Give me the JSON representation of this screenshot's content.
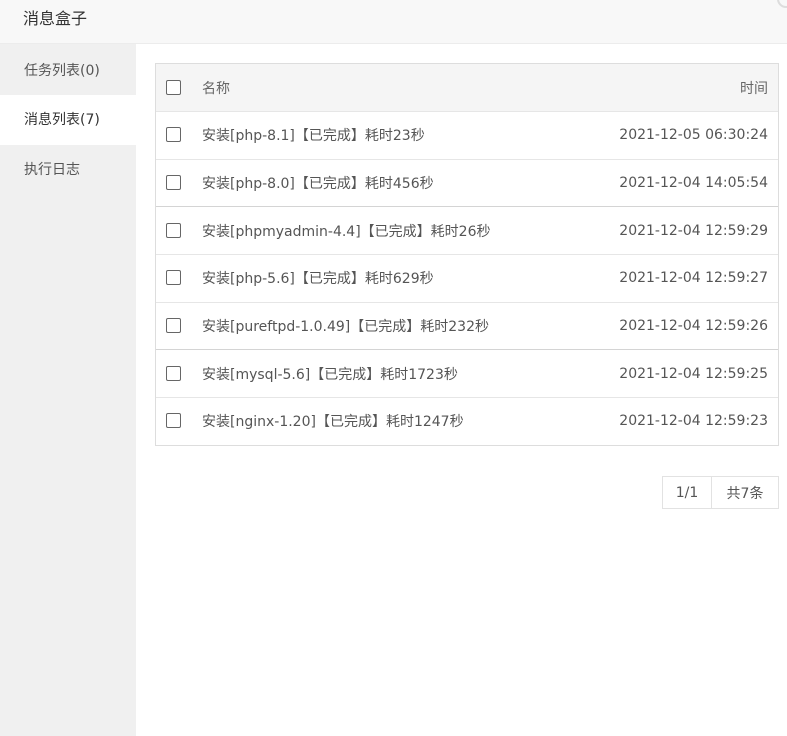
{
  "window": {
    "title": "消息盒子"
  },
  "sidebar": {
    "items": [
      {
        "label": "任务列表(0)",
        "active": false
      },
      {
        "label": "消息列表(7)",
        "active": true
      },
      {
        "label": "执行日志",
        "active": false
      }
    ]
  },
  "table": {
    "headers": {
      "name": "名称",
      "time": "时间"
    },
    "rows": [
      {
        "name": "安装[php-8.1]【已完成】耗时23秒",
        "time": "2021-12-05 06:30:24"
      },
      {
        "name": "安装[php-8.0]【已完成】耗时456秒",
        "time": "2021-12-04 14:05:54"
      },
      {
        "name": "安装[phpmyadmin-4.4]【已完成】耗时26秒",
        "time": "2021-12-04 12:59:29"
      },
      {
        "name": "安装[php-5.6]【已完成】耗时629秒",
        "time": "2021-12-04 12:59:27"
      },
      {
        "name": "安装[pureftpd-1.0.49]【已完成】耗时232秒",
        "time": "2021-12-04 12:59:26"
      },
      {
        "name": "安装[mysql-5.6]【已完成】耗时1723秒",
        "time": "2021-12-04 12:59:25"
      },
      {
        "name": "安装[nginx-1.20]【已完成】耗时1247秒",
        "time": "2021-12-04 12:59:23"
      }
    ]
  },
  "pagination": {
    "page": "1/1",
    "total": "共7条"
  }
}
